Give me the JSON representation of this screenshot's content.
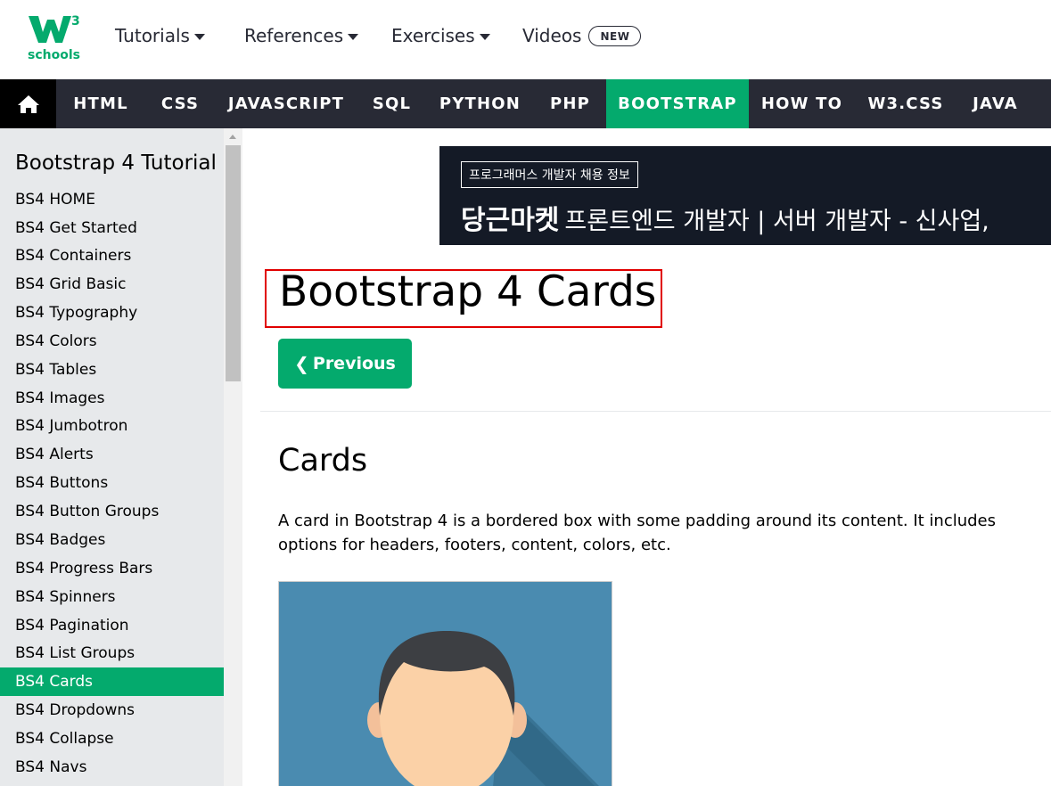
{
  "logo": {
    "mark": "W",
    "superscript": "3",
    "wordmark": "schools",
    "color": "#04aa6d"
  },
  "topnav": [
    {
      "label": "Tutorials",
      "dropdown": true
    },
    {
      "label": "References",
      "dropdown": true
    },
    {
      "label": "Exercises",
      "dropdown": true
    },
    {
      "label": "Videos",
      "badge": "NEW"
    }
  ],
  "navbar": {
    "home_icon": "home-icon",
    "items": [
      "HTML",
      "CSS",
      "JAVASCRIPT",
      "SQL",
      "PYTHON",
      "PHP",
      "BOOTSTRAP",
      "HOW TO",
      "W3.CSS",
      "JAVA"
    ],
    "active": "BOOTSTRAP"
  },
  "sidebar": {
    "title": "Bootstrap 4 Tutorial",
    "items": [
      "BS4 HOME",
      "BS4 Get Started",
      "BS4 Containers",
      "BS4 Grid Basic",
      "BS4 Typography",
      "BS4 Colors",
      "BS4 Tables",
      "BS4 Images",
      "BS4 Jumbotron",
      "BS4 Alerts",
      "BS4 Buttons",
      "BS4 Button Groups",
      "BS4 Badges",
      "BS4 Progress Bars",
      "BS4 Spinners",
      "BS4 Pagination",
      "BS4 List Groups",
      "BS4 Cards",
      "BS4 Dropdowns",
      "BS4 Collapse",
      "BS4 Navs"
    ],
    "active": "BS4 Cards"
  },
  "ad": {
    "tag": "프로그래머스 개발자 채용 정보",
    "brand": "당근마켓",
    "headline": "프론트엔드 개발자 | 서버 개발자 - 신사업,"
  },
  "main": {
    "title": "Bootstrap 4 Cards",
    "prev_label": "Previous",
    "section_title": "Cards",
    "intro": "A card in Bootstrap 4 is a bordered box with some padding around its content. It includes options for headers, footers, content, colors, etc."
  },
  "colors": {
    "accent": "#04aa6d",
    "nav_bg": "#282a35",
    "sidebar_bg": "#e7e9eb",
    "highlight": "#e00000"
  }
}
